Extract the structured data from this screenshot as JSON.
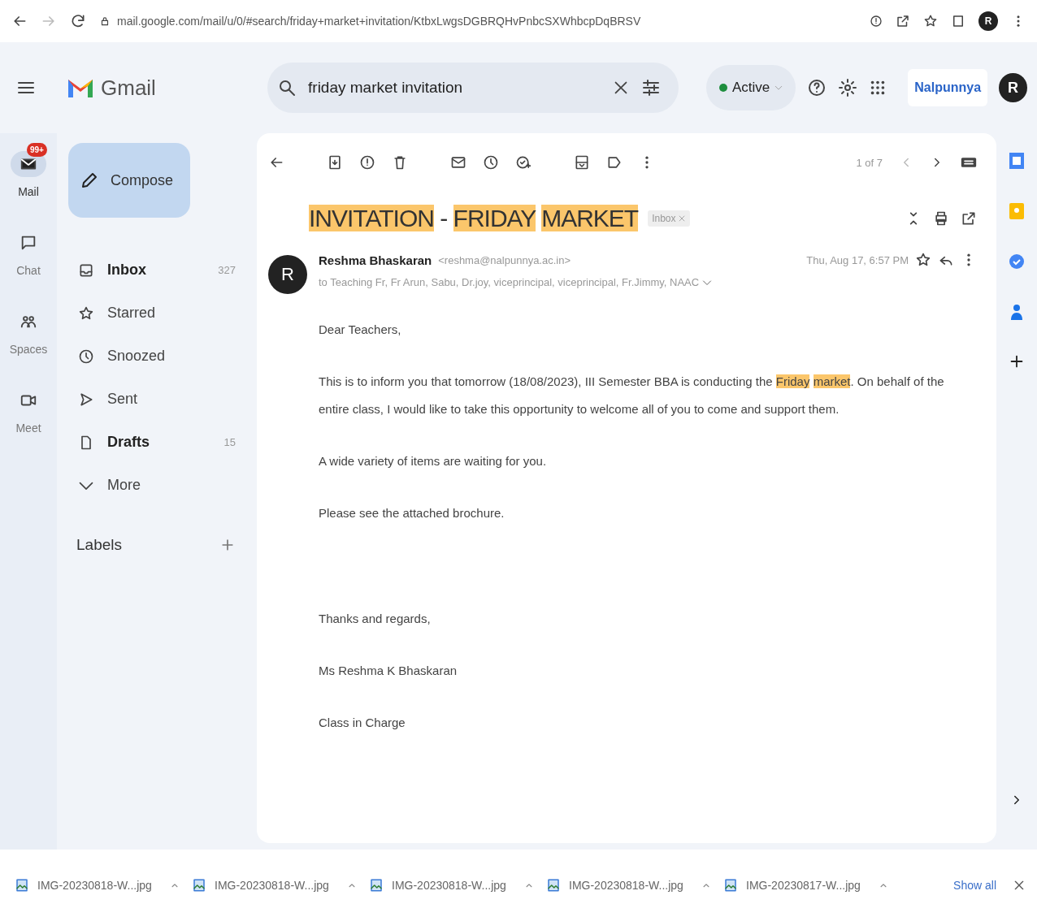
{
  "browser": {
    "url": "mail.google.com/mail/u/0/#search/friday+market+invitation/KtbxLwgsDGBRQHvPnbcSXWhbcpDqBRSV",
    "profile_initial": "R"
  },
  "header": {
    "app_name": "Gmail",
    "search": {
      "value": "friday market invitation"
    },
    "status": {
      "label": "Active",
      "on": true
    },
    "org_logo": "Nalpunnya",
    "avatar_initial": "R"
  },
  "rail": [
    {
      "kind": "mail",
      "label": "Mail",
      "badge": "99+",
      "selected": true
    },
    {
      "kind": "chat",
      "label": "Chat",
      "selected": false
    },
    {
      "kind": "spaces",
      "label": "Spaces",
      "selected": false
    },
    {
      "kind": "meet",
      "label": "Meet",
      "selected": false
    }
  ],
  "nav": {
    "compose": "Compose",
    "items": [
      {
        "kind": "inbox",
        "label": "Inbox",
        "count": "327",
        "unread": true
      },
      {
        "kind": "star",
        "label": "Starred",
        "unread": false
      },
      {
        "kind": "clock",
        "label": "Snoozed",
        "unread": false
      },
      {
        "kind": "send",
        "label": "Sent",
        "unread": false
      },
      {
        "kind": "draft",
        "label": "Drafts",
        "count": "15",
        "unread": true
      },
      {
        "kind": "more",
        "label": "More",
        "unread": false
      }
    ],
    "labels_heading": "Labels"
  },
  "toolbar": {
    "pager": "1 of 7"
  },
  "message": {
    "subject": [
      {
        "text": "INVITATION",
        "highlight": true,
        "space_after": true
      },
      {
        "text": "-",
        "highlight": false,
        "space_after": true
      },
      {
        "text": "FRIDAY",
        "highlight": true,
        "space_after": true
      },
      {
        "text": "MARKET",
        "highlight": true,
        "space_after": false
      }
    ],
    "tag": "Inbox",
    "sender_initial": "R",
    "sender_name": "Reshma Bhaskaran",
    "sender_email": "<reshma@nalpunnya.ac.in>",
    "recipients": "to Teaching Fr, Fr Arun, Sabu, Dr.joy, viceprincipal, viceprincipal, Fr.Jimmy, NAAC",
    "date": "Thu, Aug 17, 6:57 PM",
    "paragraphs": [
      {
        "kind": "text",
        "parts": [
          {
            "text": "Dear Teachers,",
            "highlight": false
          }
        ]
      },
      {
        "kind": "text",
        "parts": [
          {
            "text": "This is to inform you that tomorrow (18/08/2023), III Semester BBA is conducting the",
            "highlight": false,
            "space_after": true
          },
          {
            "text": "Friday",
            "highlight": true,
            "space_after": true
          },
          {
            "text": "market",
            "highlight": true,
            "space_after": false
          },
          {
            "text": ". On behalf of the entire class, I would like to take this opportunity to welcome all of you to come and support them.",
            "highlight": false
          }
        ]
      },
      {
        "kind": "text",
        "parts": [
          {
            "text": "A wide variety of items are waiting for you.",
            "highlight": false
          }
        ]
      },
      {
        "kind": "text",
        "parts": [
          {
            "text": "Please see the attached brochure.",
            "highlight": false
          }
        ]
      },
      {
        "kind": "signoff",
        "parts": [
          {
            "text": "Thanks and regards,",
            "highlight": false
          }
        ]
      },
      {
        "kind": "signature",
        "parts": [
          {
            "text": "Ms Reshma K Bhaskaran",
            "highlight": false
          }
        ]
      },
      {
        "kind": "signature",
        "parts": [
          {
            "text": "Class in Charge",
            "highlight": false
          }
        ]
      }
    ]
  },
  "downloads": {
    "files": [
      "IMG-20230818-W...jpg",
      "IMG-20230818-W...jpg",
      "IMG-20230818-W...jpg",
      "IMG-20230818-W...jpg",
      "IMG-20230817-W...jpg"
    ],
    "show_all": "Show all"
  }
}
